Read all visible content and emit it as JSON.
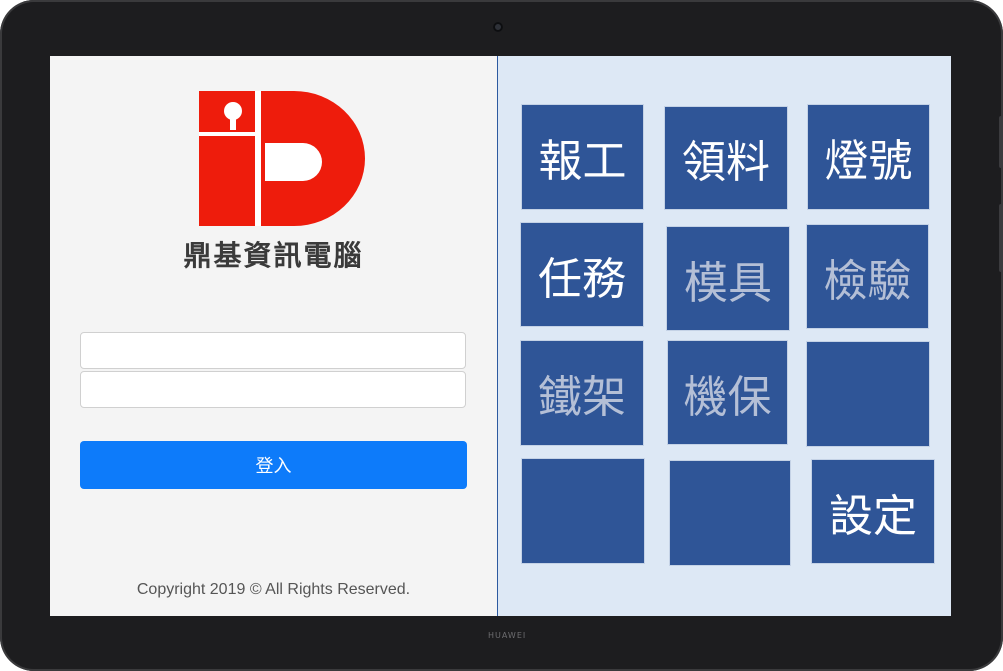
{
  "device": {
    "brand_label": "HUAWEI"
  },
  "login_panel": {
    "company_name": "鼎基資訊電腦",
    "username": {
      "value": "",
      "placeholder": ""
    },
    "password": {
      "value": "",
      "placeholder": ""
    },
    "login_label": "登入",
    "copyright": "Copyright 2019 © All Rights Reserved."
  },
  "menu": {
    "tiles": [
      {
        "label": "報工",
        "enabled": true
      },
      {
        "label": "領料",
        "enabled": true
      },
      {
        "label": "燈號",
        "enabled": true
      },
      {
        "label": "任務",
        "enabled": true
      },
      {
        "label": "模具",
        "enabled": false
      },
      {
        "label": "檢驗",
        "enabled": false
      },
      {
        "label": "鐵架",
        "enabled": false
      },
      {
        "label": "機保",
        "enabled": false
      },
      {
        "label": "",
        "enabled": false
      },
      {
        "label": "",
        "enabled": false
      },
      {
        "label": "",
        "enabled": false
      },
      {
        "label": "設定",
        "enabled": true
      }
    ]
  },
  "colors": {
    "tile_bg": "#2f5597",
    "tile_text_active": "#ffffff",
    "tile_text_disabled": "#b4bfd6",
    "login_button": "#0d7bfa",
    "logo_red": "#ee1c0c"
  }
}
